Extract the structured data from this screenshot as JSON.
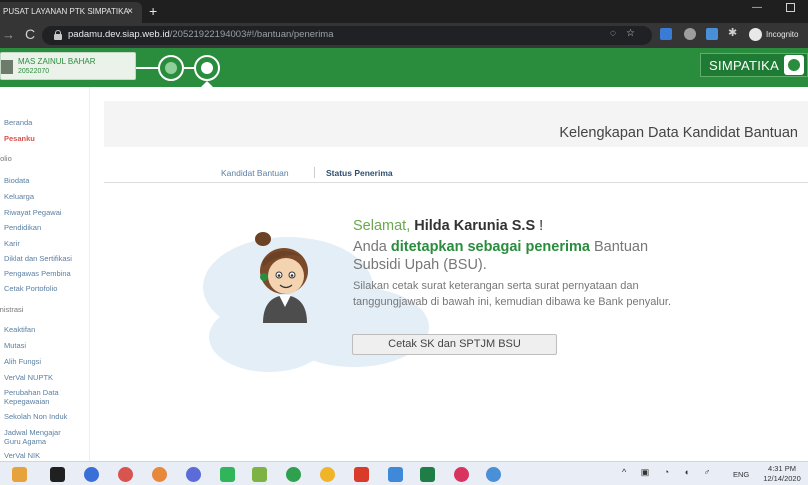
{
  "browser": {
    "tab_title": "PUSAT LAYANAN PTK SIMPATIKA",
    "tab_close": "×",
    "new_tab": "+",
    "url_host": "padamu.dev.siap.web.id",
    "url_path": "/20521922194003#!/bantuan/penerima",
    "incognito_label": "Incognito",
    "reload_glyph": "C",
    "forward_glyph": "→",
    "minimize_glyph": "—"
  },
  "header": {
    "user_name": "MAS ZAINUL BAHAR",
    "user_id": "20522070",
    "brand": "SIMPATIKA",
    "accent_color": "#2a8d3d"
  },
  "sidebar": {
    "items": [
      {
        "label": "Beranda",
        "active": false
      },
      {
        "label": "Pesanku",
        "active": true
      },
      {
        "label": "Biodata"
      },
      {
        "label": "Keluarga"
      },
      {
        "label": "Riwayat Pegawai"
      },
      {
        "label": "Pendidikan"
      },
      {
        "label": "Karir"
      },
      {
        "label": "Diklat dan Sertifikasi"
      },
      {
        "label": "Pengawas Pembina"
      },
      {
        "label": "Cetak Portofolio"
      },
      {
        "label": "Keaktifan"
      },
      {
        "label": "Mutasi"
      },
      {
        "label": "Alih Fungsi"
      },
      {
        "label": "VerVal NUPTK"
      },
      {
        "label": "Perubahan Data Kepegawaian"
      },
      {
        "label": "Sekolah Non Induk"
      },
      {
        "label": "Jadwal Mengajar Guru Agama"
      },
      {
        "label": "VerVal NIK"
      }
    ],
    "section_portfolio": "folio",
    "section_admin": "inistrasi"
  },
  "main": {
    "page_title": "Kelengkapan Data Kandidat Bantuan",
    "tabs": [
      {
        "label": "Kandidat Bantuan",
        "active": false
      },
      {
        "label": "Status Penerima",
        "active": true
      }
    ],
    "greeting_prefix": "Selamat,",
    "recipient_name": "Hilda Karunia S.S",
    "greeting_suffix": "!",
    "status_prefix": "Anda",
    "status_highlight": "ditetapkan sebagai penerima",
    "status_suffix": "Bantuan Subsidi Upah (BSU).",
    "instructions": "Silakan cetak surat keterangan serta surat pernyataan dan tanggungjawab di bawah ini, kemudian dibawa ke Bank penyalur.",
    "print_button": "Cetak SK dan SPTJM BSU"
  },
  "taskbar": {
    "tray_glyphs": "^ ▣ ◔ ◖ ♂",
    "language": "ENG",
    "time": "4:31 PM",
    "date": "12/14/2020"
  }
}
